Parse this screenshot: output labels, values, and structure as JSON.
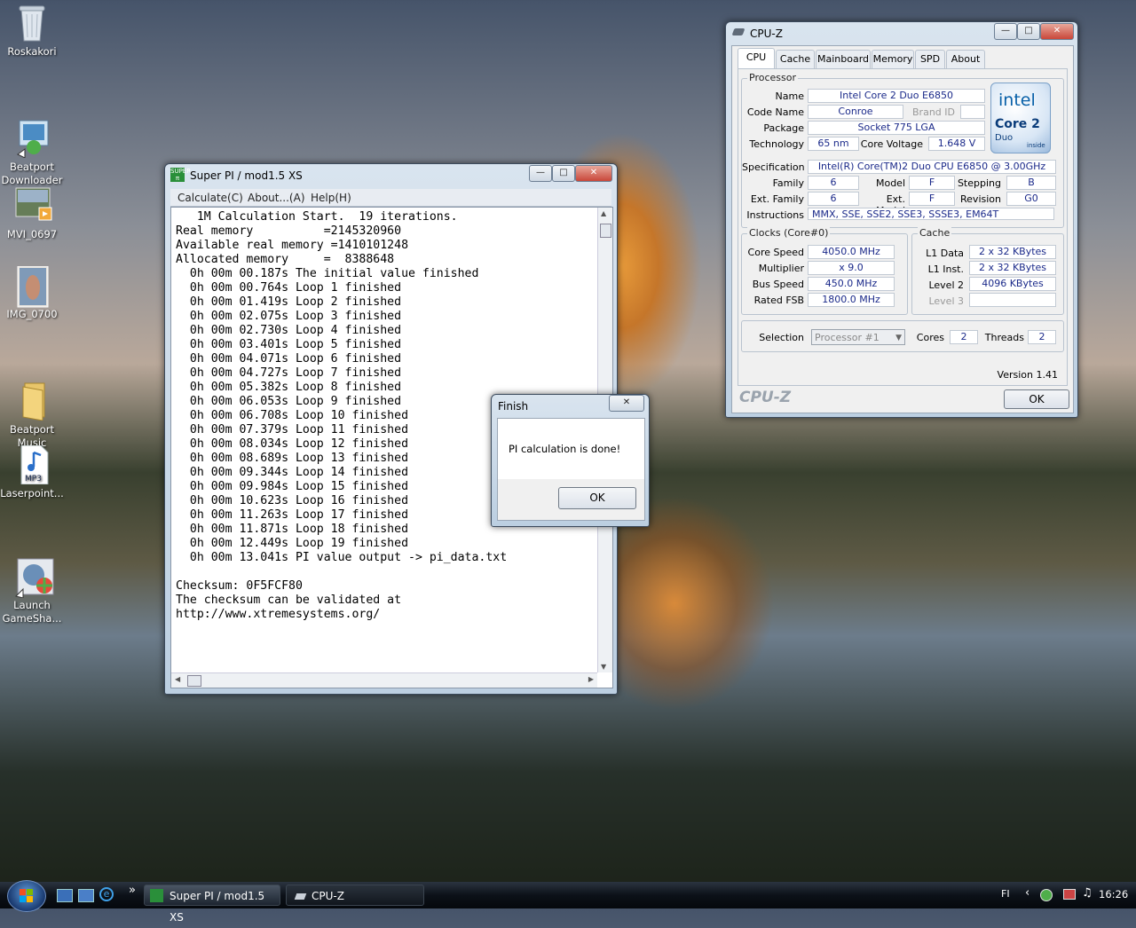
{
  "desktop": {
    "icons": [
      {
        "label": "Roskakori"
      },
      {
        "label": "Beatport\nDownloader"
      },
      {
        "label": "MVI_0697"
      },
      {
        "label": "IMG_0700"
      },
      {
        "label": "Beatport\nMusic"
      },
      {
        "label": "Laserpoint..."
      },
      {
        "label": "Launch\nGameSha..."
      }
    ]
  },
  "superpi": {
    "title": "Super PI / mod1.5 XS",
    "menu": [
      "Calculate(C)",
      "About...(A)",
      "Help(H)"
    ],
    "lines": [
      "   1M Calculation Start.  19 iterations.",
      "Real memory          =2145320960",
      "Available real memory =1410101248",
      "Allocated memory     =  8388648",
      "  0h 00m 00.187s The initial value finished",
      "  0h 00m 00.764s Loop 1 finished",
      "  0h 00m 01.419s Loop 2 finished",
      "  0h 00m 02.075s Loop 3 finished",
      "  0h 00m 02.730s Loop 4 finished",
      "  0h 00m 03.401s Loop 5 finished",
      "  0h 00m 04.071s Loop 6 finished",
      "  0h 00m 04.727s Loop 7 finished",
      "  0h 00m 05.382s Loop 8 finished",
      "  0h 00m 06.053s Loop 9 finished",
      "  0h 00m 06.708s Loop 10 finished",
      "  0h 00m 07.379s Loop 11 finished",
      "  0h 00m 08.034s Loop 12 finished",
      "  0h 00m 08.689s Loop 13 finished",
      "  0h 00m 09.344s Loop 14 finished",
      "  0h 00m 09.984s Loop 15 finished",
      "  0h 00m 10.623s Loop 16 finished",
      "  0h 00m 11.263s Loop 17 finished",
      "  0h 00m 11.871s Loop 18 finished",
      "  0h 00m 12.449s Loop 19 finished",
      "  0h 00m 13.041s PI value output -> pi_data.txt",
      "",
      "Checksum: 0F5FCF80",
      "The checksum can be validated at",
      "http://www.xtremesystems.org/"
    ]
  },
  "finish": {
    "title": "Finish",
    "message": "PI calculation is done!",
    "ok": "OK"
  },
  "cpuz": {
    "title": "CPU-Z",
    "tabs": [
      "CPU",
      "Cache",
      "Mainboard",
      "Memory",
      "SPD",
      "About"
    ],
    "processor_group": "Processor",
    "name_label": "Name",
    "name": "Intel Core 2 Duo E6850",
    "codename_label": "Code Name",
    "codename": "Conroe",
    "brandid_label": "Brand ID",
    "package_label": "Package",
    "package": "Socket 775 LGA",
    "technology_label": "Technology",
    "technology": "65 nm",
    "corevoltage_label": "Core Voltage",
    "corevoltage": "1.648 V",
    "spec_label": "Specification",
    "spec": "Intel(R) Core(TM)2 Duo CPU     E6850  @ 3.00GHz",
    "family_label": "Family",
    "family": "6",
    "model_label": "Model",
    "model": "F",
    "stepping_label": "Stepping",
    "stepping": "B",
    "extfamily_label": "Ext. Family",
    "extfamily": "6",
    "extmodel_label": "Ext. Model",
    "extmodel": "F",
    "revision_label": "Revision",
    "revision": "G0",
    "instructions_label": "Instructions",
    "instructions": "MMX, SSE, SSE2, SSE3, SSSE3, EM64T",
    "clocks_group": "Clocks (Core#0)",
    "corespeed_label": "Core Speed",
    "corespeed": "4050.0 MHz",
    "multiplier_label": "Multiplier",
    "multiplier": "x 9.0",
    "busspeed_label": "Bus Speed",
    "busspeed": "450.0 MHz",
    "ratedfsb_label": "Rated FSB",
    "ratedfsb": "1800.0 MHz",
    "cache_group": "Cache",
    "l1data_label": "L1 Data",
    "l1data": "2 x 32 KBytes",
    "l1inst_label": "L1 Inst.",
    "l1inst": "2 x 32 KBytes",
    "level2_label": "Level 2",
    "level2": "4096 KBytes",
    "level3_label": "Level 3",
    "selection_label": "Selection",
    "selection": "Processor #1",
    "cores_label": "Cores",
    "cores": "2",
    "threads_label": "Threads",
    "threads": "2",
    "version": "Version 1.41",
    "brand_footer": "CPU-Z",
    "ok": "OK",
    "logo_intel": "intel",
    "logo_core": "Core 2",
    "logo_duo": "Duo",
    "logo_inside": "inside"
  },
  "taskbar": {
    "tasks": [
      "Super PI / mod1.5 XS",
      "CPU-Z"
    ],
    "lang": "FI",
    "clock": "16:26",
    "chevron": "»"
  }
}
